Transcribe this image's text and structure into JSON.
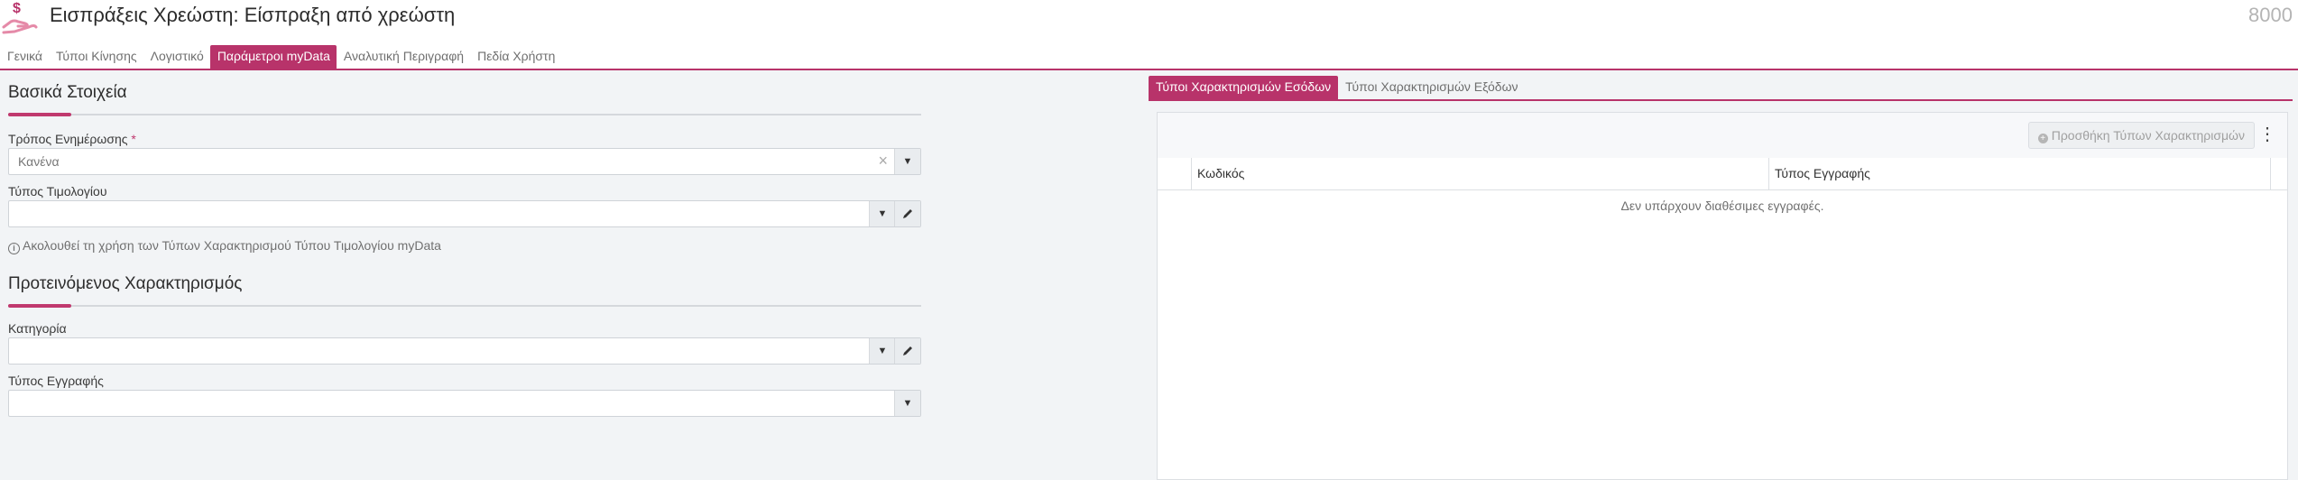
{
  "header": {
    "title": "Εισπράξεις Χρεώστη: Είσπραξη από χρεώστη",
    "record_number": "8000",
    "icon": "money-hand-icon",
    "accent_color": "#b8336a"
  },
  "tabs": [
    {
      "label": "Γενικά",
      "active": false
    },
    {
      "label": "Τύποι Κίνησης",
      "active": false
    },
    {
      "label": "Λογιστικό",
      "active": false
    },
    {
      "label": "Παράμετροι myData",
      "active": true
    },
    {
      "label": "Αναλυτική Περιγραφή",
      "active": false
    },
    {
      "label": "Πεδία Χρήστη",
      "active": false
    }
  ],
  "basic": {
    "title": "Βασικά Στοιχεία",
    "update_mode": {
      "label": "Τρόπος Ενημέρωσης",
      "required_mark": "*",
      "value": "Κανένα"
    },
    "invoice_type": {
      "label": "Τύπος Τιμολογίου",
      "value": ""
    },
    "hint": "Ακολουθεί τη χρήση των Τύπων Χαρακτηρισμού Τύπου Τιμολογίου myData"
  },
  "proposed": {
    "title": "Προτεινόμενος Χαρακτηρισμός",
    "category": {
      "label": "Κατηγορία",
      "value": ""
    },
    "record_type": {
      "label": "Τύπος Εγγραφής",
      "value": ""
    }
  },
  "right_tabs": [
    {
      "label": "Τύποι Χαρακτηρισμών Εσόδων",
      "active": true
    },
    {
      "label": "Τύποι Χαρακτηρισμών Εξόδων",
      "active": false
    }
  ],
  "grid": {
    "add_button": "Προσθήκη Τύπων Χαρακτηρισμών",
    "columns": [
      "Κωδικός",
      "Τύπος Εγγραφής"
    ],
    "empty_message": "Δεν υπάρχουν διαθέσιμες εγγραφές."
  }
}
